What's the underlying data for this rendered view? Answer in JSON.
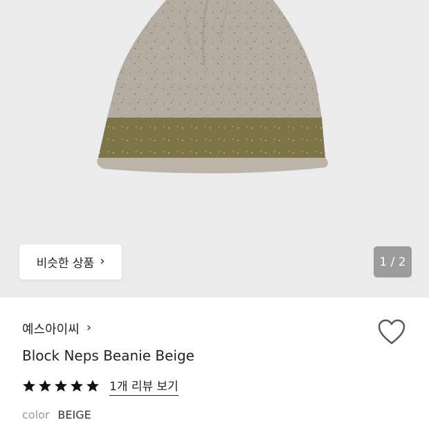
{
  "gallery": {
    "similar_button_label": "비슷한 상품",
    "chevron_glyph": "›",
    "counter": "1 / 2",
    "image_name": "beanie-product-photo"
  },
  "product": {
    "brand": "예스아이씨",
    "brand_chevron": "›",
    "title": "Block Neps Beanie Beige",
    "rating_stars": 5,
    "review_link": "1개 리뷰 보기",
    "color_label": "color",
    "color_value": "BEIGE"
  },
  "colors": {
    "gallery_bg": "#ebebeb",
    "beanie_body": "#b4aba1",
    "beanie_band": "#7d7448",
    "counter_bg": "#9c9c9c"
  }
}
